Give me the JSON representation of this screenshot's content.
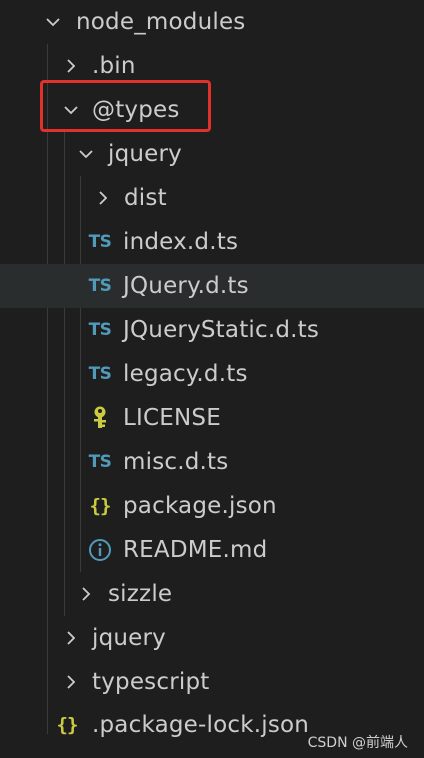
{
  "explorer": {
    "items": [
      {
        "label": "node_modules",
        "kind": "folder",
        "expanded": true,
        "icon": "chevron-down-icon"
      },
      {
        "label": ".bin",
        "kind": "folder",
        "expanded": false,
        "icon": "chevron-right-icon"
      },
      {
        "label": "@types",
        "kind": "folder",
        "expanded": true,
        "icon": "chevron-down-icon",
        "highlighted": true
      },
      {
        "label": "jquery",
        "kind": "folder",
        "expanded": true,
        "icon": "chevron-down-icon"
      },
      {
        "label": "dist",
        "kind": "folder",
        "expanded": false,
        "icon": "chevron-right-icon"
      },
      {
        "label": "index.d.ts",
        "kind": "file",
        "icon": "typescript-icon",
        "badge": "TS"
      },
      {
        "label": "JQuery.d.ts",
        "kind": "file",
        "icon": "typescript-icon",
        "badge": "TS",
        "hover": true
      },
      {
        "label": "JQueryStatic.d.ts",
        "kind": "file",
        "icon": "typescript-icon",
        "badge": "TS"
      },
      {
        "label": "legacy.d.ts",
        "kind": "file",
        "icon": "typescript-icon",
        "badge": "TS"
      },
      {
        "label": "LICENSE",
        "kind": "file",
        "icon": "license-key-icon"
      },
      {
        "label": "misc.d.ts",
        "kind": "file",
        "icon": "typescript-icon",
        "badge": "TS"
      },
      {
        "label": "package.json",
        "kind": "file",
        "icon": "json-icon",
        "badge": "{}"
      },
      {
        "label": "README.md",
        "kind": "file",
        "icon": "info-icon"
      },
      {
        "label": "sizzle",
        "kind": "folder",
        "expanded": false,
        "icon": "chevron-right-icon"
      },
      {
        "label": "jquery",
        "kind": "folder",
        "expanded": false,
        "icon": "chevron-right-icon"
      },
      {
        "label": "typescript",
        "kind": "folder",
        "expanded": false,
        "icon": "chevron-right-icon"
      },
      {
        "label": ".package-lock.json",
        "kind": "file",
        "icon": "json-icon",
        "badge": "{}"
      }
    ]
  },
  "watermark": "CSDN @前端人",
  "colors": {
    "background": "#1e1e1e",
    "text": "#cccccc",
    "ts_icon": "#519aba",
    "json_icon": "#cbcb41",
    "highlight_border": "#e0312b",
    "hover_row": "#2a2d2e"
  }
}
